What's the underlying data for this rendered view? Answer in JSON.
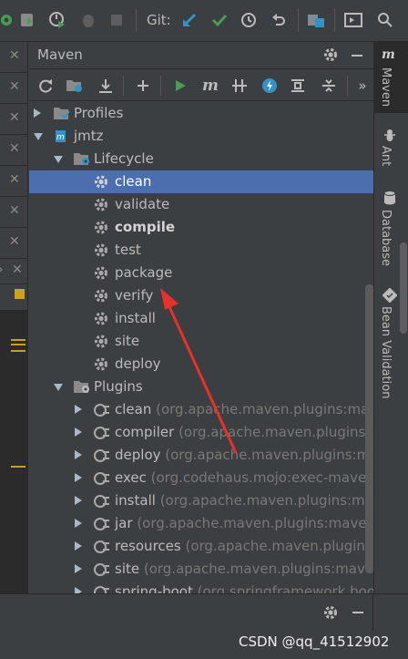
{
  "toolbar": {
    "git_label": "Git:"
  },
  "maven": {
    "title": "Maven",
    "tree": {
      "profiles": "Profiles",
      "project": "jmtz",
      "lifecycle": "Lifecycle",
      "lifecycle_items": [
        "clean",
        "validate",
        "compile",
        "test",
        "package",
        "verify",
        "install",
        "site",
        "deploy"
      ],
      "plugins": "Plugins",
      "plugin_items": [
        {
          "name": "clean",
          "coords": "(org.apache.maven.plugins:maven"
        },
        {
          "name": "compiler",
          "coords": "(org.apache.maven.plugins:ma"
        },
        {
          "name": "deploy",
          "coords": "(org.apache.maven.plugins:mav"
        },
        {
          "name": "exec",
          "coords": "(org.codehaus.mojo:exec-maven-p"
        },
        {
          "name": "install",
          "coords": "(org.apache.maven.plugins:mave"
        },
        {
          "name": "jar",
          "coords": "(org.apache.maven.plugins:maven-ja"
        },
        {
          "name": "resources",
          "coords": "(org.apache.maven.plugins:m"
        },
        {
          "name": "site",
          "coords": "(org.apache.maven.plugins:maven-s"
        },
        {
          "name": "spring-boot",
          "coords": "(org.springframework.boo"
        }
      ]
    }
  },
  "right_tools": [
    "Maven",
    "Ant",
    "Database",
    "Bean Validation"
  ],
  "watermark": "CSDN @qq_41512902",
  "colors": {
    "selection": "#4b6eaf",
    "annotation": "#e8312a",
    "run_green": "#499c54",
    "git_blue": "#3592c4"
  }
}
